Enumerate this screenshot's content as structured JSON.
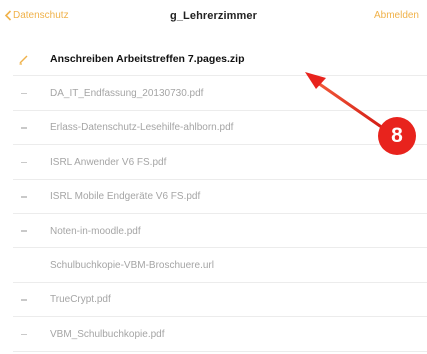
{
  "navbar": {
    "back_label": "Datenschutz",
    "title": "g_Lehrerzimmer",
    "logout_label": "Abmelden"
  },
  "files": [
    {
      "name": "Anschreiben Arbeitstreffen 7.pages.zip",
      "icon": "pencil-icon",
      "active": true
    },
    {
      "name": "DA_IT_Endfassung_20130730.pdf",
      "icon": "dash-icon",
      "active": false
    },
    {
      "name": "Erlass-Datenschutz-Lesehilfe-ahlborn.pdf",
      "icon": "dash-icon",
      "active": false
    },
    {
      "name": "ISRL Anwender V6 FS.pdf",
      "icon": "dash-icon",
      "active": false
    },
    {
      "name": "ISRL Mobile Endgeräte V6 FS.pdf",
      "icon": "dash-icon",
      "active": false
    },
    {
      "name": "Noten-in-moodle.pdf",
      "icon": "dash-icon",
      "active": false
    },
    {
      "name": "Schulbuchkopie-VBM-Broschuere.url",
      "icon": "none",
      "active": false
    },
    {
      "name": "TrueCrypt.pdf",
      "icon": "dash-icon",
      "active": false
    },
    {
      "name": "VBM_Schulbuchkopie.pdf",
      "icon": "dash-icon",
      "active": false
    }
  ],
  "annotation": {
    "badge_number": "8",
    "color": "#e8231d"
  },
  "colors": {
    "accent": "#f0b24a",
    "annotation_red": "#e8231d"
  }
}
